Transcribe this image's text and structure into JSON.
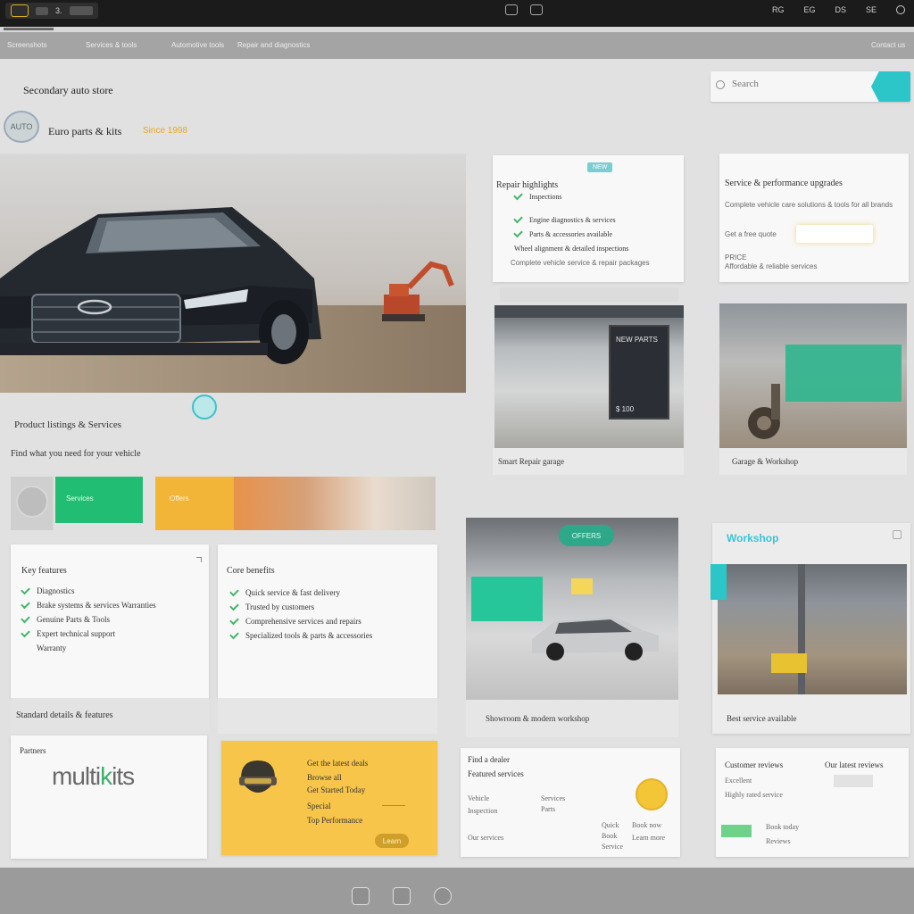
{
  "titlebar": {
    "left_text_1": "3.",
    "left_box": "",
    "right_items": [
      "RG",
      "EG",
      "DS",
      "SE"
    ]
  },
  "navbar": {
    "links": [
      "Screenshots",
      "Services & tools",
      "Automotive tools",
      "Repair and diagnostics"
    ],
    "right_link": "Contact us"
  },
  "header": {
    "site_title": "Secondary auto store",
    "brand_logo_text": "AUTO",
    "brand_name": "Euro parts & kits",
    "brand_tagline": "Since 1998",
    "search_placeholder": "Search"
  },
  "hero": {
    "heading": "Product listings & Services",
    "subheading": "Find what you need for your vehicle"
  },
  "strip": {
    "green_label": "Services",
    "yellow_label": "Offers"
  },
  "card_features": {
    "title": "Key features",
    "items": [
      "Diagnostics",
      "Brake systems & services Warranties",
      "Genuine Parts & Tools",
      "Expert technical support"
    ],
    "extra": "Warranty",
    "footer": "Standard details & features"
  },
  "card_benefits": {
    "title": "Core benefits",
    "items": [
      "Quick service & fast delivery",
      "Trusted by customers",
      "Comprehensive services and repairs",
      "Specialized tools & parts & accessories"
    ],
    "footer": ""
  },
  "card_logo": {
    "label": "Partners",
    "big_pre": "multi",
    "big_mid": "k",
    "big_post": "its"
  },
  "card_yellow": {
    "line1": "Get the latest deals",
    "line2": "Browse all",
    "line3": "Get Started Today",
    "line4": "Special",
    "line5": "Top Performance",
    "button": "Learn"
  },
  "col2_top": {
    "badge": "NEW",
    "title": "Repair highlights",
    "items": [
      "Inspections",
      "Engine diagnostics & services",
      "Parts & accessories available",
      "Wheel alignment & detailed inspections",
      "Complete vehicle service & repair packages"
    ]
  },
  "col3_top": {
    "title": "Service & performance upgrades",
    "line1": "Complete vehicle care solutions & tools for all brands",
    "line2": "Get a free quote",
    "line3": "PRICE",
    "line4": "Affordable & reliable services"
  },
  "photo1": {
    "panel_top": "NEW PARTS",
    "panel_bottom": "$ 100",
    "caption": "Smart Repair garage"
  },
  "photo2": {
    "caption": "Garage & Workshop"
  },
  "photo3": {
    "tag": "OFFERS",
    "caption": "Showroom & modern workshop"
  },
  "col3_mid": {
    "title": "Workshop",
    "caption": "Best service available"
  },
  "card_c": {
    "title": "Find a dealer",
    "subtitle": "Featured services",
    "col1": [
      "Vehicle",
      "Inspection",
      "Our services"
    ],
    "col2": [
      "Services",
      "Parts",
      ""
    ],
    "col3": [
      "Quick",
      "Book",
      "Service"
    ],
    "col4": [
      "Book now",
      "Learn more"
    ]
  },
  "card_d": {
    "title": "Customer reviews",
    "title_right": "Our latest reviews",
    "line1": "Excellent",
    "line2": "Highly rated service",
    "line3": "Book today",
    "line4": "Reviews"
  },
  "colors": {
    "teal": "#2cc6c8",
    "green": "#21bd73",
    "yellow": "#f7c54a",
    "accent_orange": "#e8a91e"
  }
}
